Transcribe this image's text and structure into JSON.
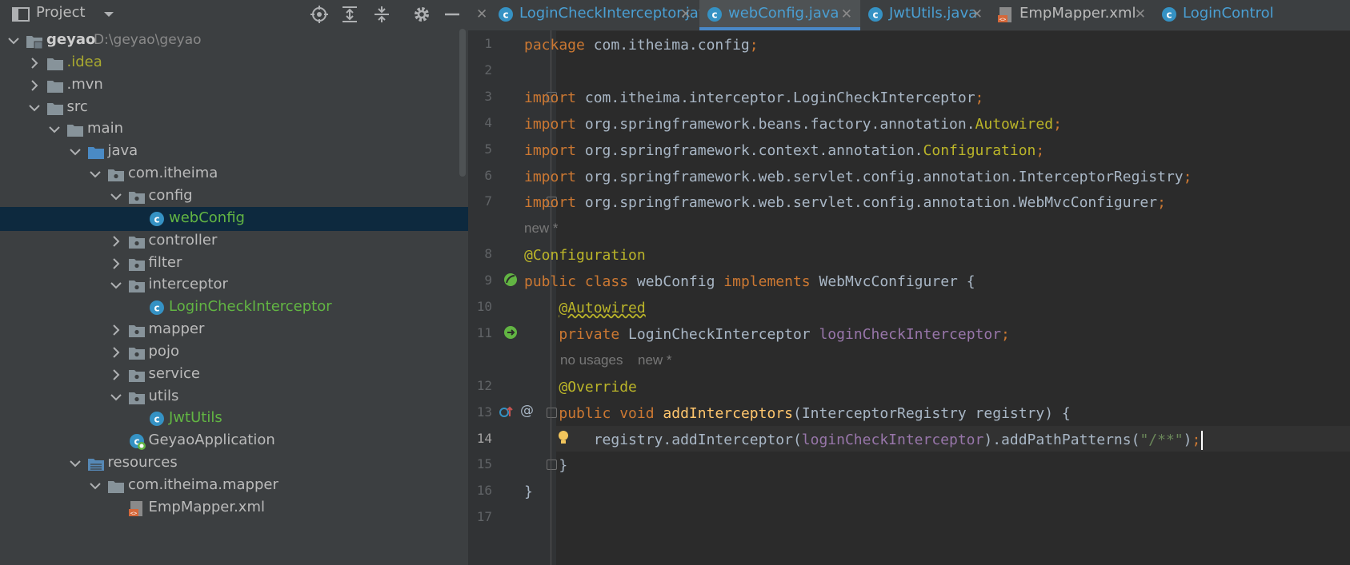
{
  "project_panel": {
    "title": "Project",
    "tree": [
      {
        "label": "geyao",
        "path": "D:\\geyao\\geyao",
        "kind": "module",
        "expanded": true,
        "color": "#cdcdcd"
      },
      {
        "label": ".idea",
        "kind": "folder",
        "expanded": false,
        "color": "#a8a82f"
      },
      {
        "label": ".mvn",
        "kind": "folder",
        "expanded": false,
        "color": "#bbbbbb"
      },
      {
        "label": "src",
        "kind": "folder",
        "expanded": true,
        "color": "#bbbbbb"
      },
      {
        "label": "main",
        "kind": "folder",
        "expanded": true,
        "color": "#bbbbbb"
      },
      {
        "label": "java",
        "kind": "source-folder",
        "expanded": true,
        "color": "#bbbbbb"
      },
      {
        "label": "com.itheima",
        "kind": "package",
        "expanded": true,
        "color": "#bbbbbb"
      },
      {
        "label": "config",
        "kind": "package",
        "expanded": true,
        "color": "#bbbbbb"
      },
      {
        "label": "webConfig",
        "kind": "class",
        "selected": true,
        "color": "#62b543"
      },
      {
        "label": "controller",
        "kind": "package",
        "expanded": false,
        "color": "#bbbbbb"
      },
      {
        "label": "filter",
        "kind": "package",
        "expanded": false,
        "color": "#bbbbbb"
      },
      {
        "label": "interceptor",
        "kind": "package",
        "expanded": true,
        "color": "#bbbbbb"
      },
      {
        "label": "LoginCheckInterceptor",
        "kind": "class",
        "color": "#62b543"
      },
      {
        "label": "mapper",
        "kind": "package",
        "expanded": false,
        "color": "#bbbbbb"
      },
      {
        "label": "pojo",
        "kind": "package",
        "expanded": false,
        "color": "#bbbbbb"
      },
      {
        "label": "service",
        "kind": "package",
        "expanded": false,
        "color": "#bbbbbb"
      },
      {
        "label": "utils",
        "kind": "package",
        "expanded": true,
        "color": "#bbbbbb"
      },
      {
        "label": "JwtUtils",
        "kind": "class",
        "color": "#62b543"
      },
      {
        "label": "GeyaoApplication",
        "kind": "spring-class",
        "color": "#bbbbbb"
      },
      {
        "label": "resources",
        "kind": "resource-folder",
        "expanded": true,
        "color": "#bbbbbb"
      },
      {
        "label": "com.itheima.mapper",
        "kind": "folder",
        "expanded": true,
        "color": "#bbbbbb"
      },
      {
        "label": "EmpMapper.xml",
        "kind": "xml",
        "color": "#bbbbbb"
      }
    ],
    "toolbar_icons": [
      "locate-icon",
      "expand-all-icon",
      "collapse-all-icon",
      "gear-icon",
      "minimize-icon"
    ]
  },
  "editor": {
    "tabs": [
      {
        "label": "LoginCheckInterceptor.java",
        "kind": "class",
        "color": "#4a9fd3",
        "active": false
      },
      {
        "label": "webConfig.java",
        "kind": "class",
        "color": "#4a9fd3",
        "active": true
      },
      {
        "label": "JwtUtils.java",
        "kind": "class",
        "color": "#4a9fd3",
        "active": false
      },
      {
        "label": "EmpMapper.xml",
        "kind": "xml",
        "color": "#bbbbbb",
        "active": false
      },
      {
        "label": "LoginControl",
        "kind": "class",
        "color": "#4a9fd3",
        "active": false
      }
    ],
    "current_line": "14",
    "hints": {
      "class_hint": "new *",
      "method_hint_usages": "no usages",
      "method_hint_new": "new *"
    },
    "code": {
      "l1": {
        "ln": "1",
        "parts": [
          [
            "kw",
            "package"
          ],
          [
            "",
            " com.itheima.config"
          ],
          [
            "kw",
            ";"
          ]
        ]
      },
      "l2": {
        "ln": "2",
        "parts": []
      },
      "l3": {
        "ln": "3",
        "parts": [
          [
            "kw",
            "import"
          ],
          [
            "",
            " com.itheima.interceptor.LoginCheckInterceptor"
          ],
          [
            "kw",
            ";"
          ]
        ]
      },
      "l4": {
        "ln": "4",
        "parts": [
          [
            "kw",
            "import"
          ],
          [
            "",
            " org.springframework.beans.factory.annotation."
          ],
          [
            "ann",
            "Autowired"
          ],
          [
            "kw",
            ";"
          ]
        ]
      },
      "l5": {
        "ln": "5",
        "parts": [
          [
            "kw",
            "import"
          ],
          [
            "",
            " org.springframework.context.annotation."
          ],
          [
            "ann",
            "Configuration"
          ],
          [
            "kw",
            ";"
          ]
        ]
      },
      "l6": {
        "ln": "6",
        "parts": [
          [
            "kw",
            "import"
          ],
          [
            "",
            " org.springframework.web.servlet.config.annotation.InterceptorRegistry"
          ],
          [
            "kw",
            ";"
          ]
        ]
      },
      "l7": {
        "ln": "7",
        "parts": [
          [
            "kw",
            "import"
          ],
          [
            "",
            " org.springframework.web.servlet.config.annotation.WebMvcConfigurer"
          ],
          [
            "kw",
            ";"
          ]
        ]
      },
      "l8": {
        "ln": "8",
        "parts": [
          [
            "ann",
            "@Configuration"
          ]
        ]
      },
      "l9": {
        "ln": "9",
        "parts": [
          [
            "kw",
            "public class"
          ],
          [
            "",
            " webConfig "
          ],
          [
            "kw",
            "implements"
          ],
          [
            "",
            " WebMvcConfigurer {"
          ]
        ]
      },
      "l10": {
        "ln": "10",
        "parts": [
          [
            "",
            "    "
          ],
          [
            "ann wavy",
            "@Autowired"
          ]
        ]
      },
      "l11": {
        "ln": "11",
        "parts": [
          [
            "",
            "    "
          ],
          [
            "kw",
            "private"
          ],
          [
            "",
            " LoginCheckInterceptor "
          ],
          [
            "fld",
            "loginCheckInterceptor"
          ],
          [
            "kw",
            ";"
          ]
        ]
      },
      "l12": {
        "ln": "12",
        "parts": [
          [
            "",
            "    "
          ],
          [
            "ann",
            "@Override"
          ]
        ]
      },
      "l13": {
        "ln": "13",
        "parts": [
          [
            "",
            "    "
          ],
          [
            "kw",
            "public void"
          ],
          [
            "",
            " "
          ],
          [
            "fn",
            "addInterceptors"
          ],
          [
            "",
            "(InterceptorRegistry registry) {"
          ]
        ]
      },
      "l14": {
        "ln": "14",
        "parts": [
          [
            "",
            "        registry.addInterceptor("
          ],
          [
            "fld",
            "loginCheckInterceptor"
          ],
          [
            "",
            ").addPathPatterns("
          ],
          [
            "str",
            "\"/**\""
          ],
          [
            "",
            ")"
          ],
          [
            "kw",
            ";"
          ]
        ]
      },
      "l15": {
        "ln": "15",
        "parts": [
          [
            "",
            "    }"
          ]
        ]
      },
      "l16": {
        "ln": "16",
        "parts": [
          [
            "",
            "}"
          ]
        ]
      },
      "l17": {
        "ln": "17",
        "parts": []
      }
    }
  }
}
